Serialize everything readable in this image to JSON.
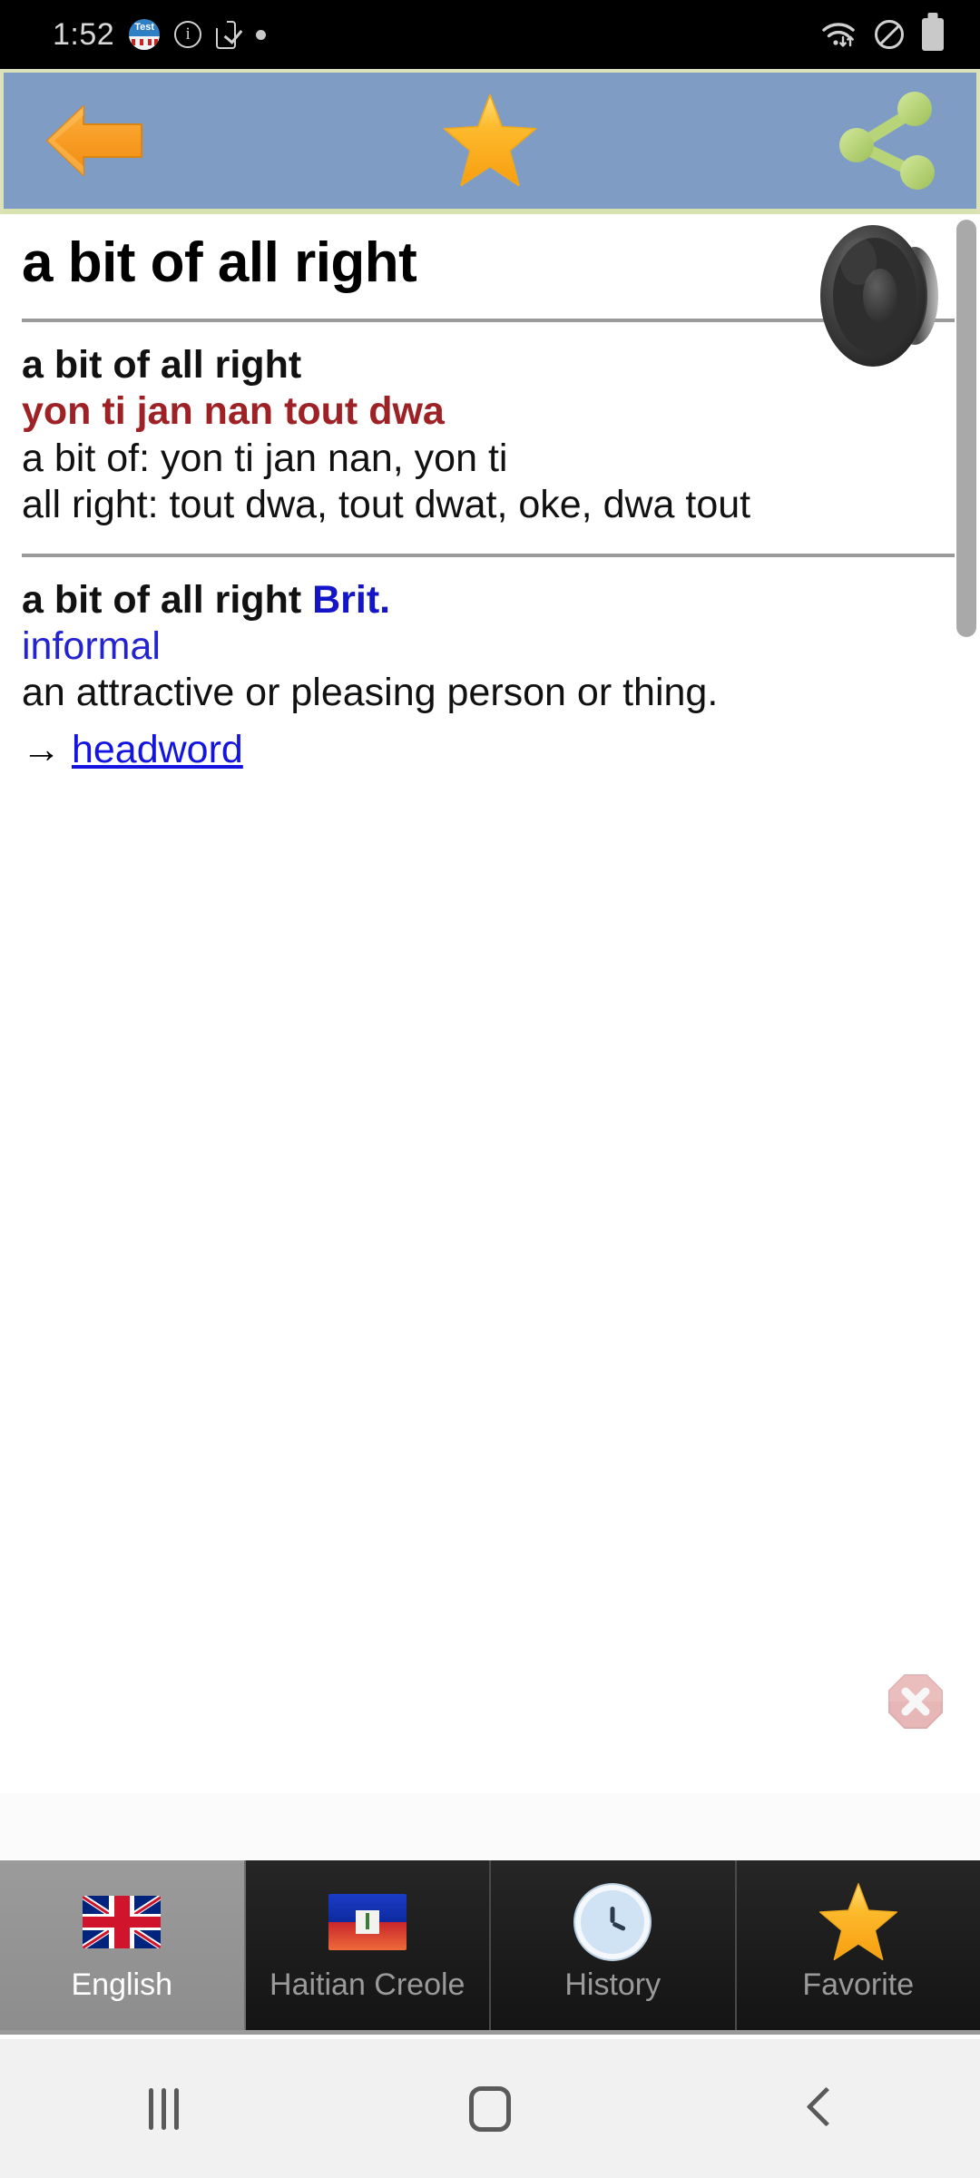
{
  "status_bar": {
    "time": "1:52",
    "icons_left": [
      "app-badge-test",
      "info-icon",
      "phone-check-icon",
      "dot-icon"
    ],
    "app_badge_label": "Test",
    "icons_right": [
      "wifi-icon",
      "do-not-disturb-icon",
      "battery-icon"
    ]
  },
  "toolbar": {
    "background_color": "#7f9dc4",
    "border_color": "#dde3b8",
    "back_label": "Back",
    "favorite_label": "Favorite",
    "share_label": "Share"
  },
  "entry": {
    "headword": "a bit of all right",
    "speaker_label": "Pronounce",
    "translation_block": {
      "term": "a bit of all right",
      "translation": "yon ti jan nan tout dwa",
      "sub_lines": [
        "a bit of: yon ti jan nan, yon ti",
        "all right: tout dwa, tout dwat, oke, dwa tout"
      ]
    },
    "definition_block": {
      "term": "a bit of all right",
      "region_label": "Brit.",
      "register_label": "informal",
      "definition": "an attractive or pleasing person or thing.",
      "cross_ref_arrow": "→",
      "cross_ref_link": "headword"
    }
  },
  "colors": {
    "translation_red": "#9e2225",
    "label_blue": "#1414c8",
    "link_blue": "#1414e0",
    "rule_gray": "#9a9a9a"
  },
  "close_button": {
    "label": "Close"
  },
  "scrollbar": {
    "label": "Vertical scrollbar"
  },
  "tabs": [
    {
      "label": "English",
      "icon": "uk-flag-icon",
      "active": true
    },
    {
      "label": "Haitian Creole",
      "icon": "haiti-flag-icon",
      "active": false
    },
    {
      "label": "History",
      "icon": "clock-icon",
      "active": false
    },
    {
      "label": "Favorite",
      "icon": "star-icon",
      "active": false
    }
  ],
  "nav_bar": {
    "recents_label": "Recents",
    "home_label": "Home",
    "back_label": "Back"
  }
}
